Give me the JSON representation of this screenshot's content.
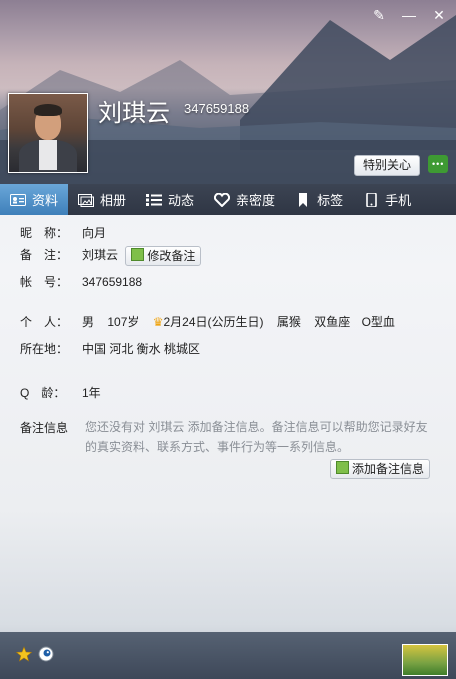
{
  "window": {
    "buttons": [
      "✎",
      "—",
      "✕"
    ]
  },
  "profile": {
    "name": "刘琪云",
    "qq_number": "347659188",
    "special_care_label": "特别关心"
  },
  "tabs": [
    {
      "label": "资料",
      "icon": "profile-card-icon",
      "active": true
    },
    {
      "label": "相册",
      "icon": "album-icon",
      "active": false
    },
    {
      "label": "动态",
      "icon": "feed-icon",
      "active": false
    },
    {
      "label": "亲密度",
      "icon": "heart-icon",
      "active": false
    },
    {
      "label": "标签",
      "icon": "bookmark-icon",
      "active": false
    },
    {
      "label": "手机",
      "icon": "phone-icon",
      "active": false
    }
  ],
  "info": {
    "nickname_label": "昵　称：",
    "nickname": "向月",
    "remark_label": "备　注：",
    "remark": "刘琪云",
    "edit_remark_label": "修改备注",
    "account_label": "帐　号：",
    "account": "347659188",
    "personal_label": "个　人：",
    "gender": "男",
    "age": "107岁",
    "birthday": "2月24日(公历生日)",
    "zodiac": "属猴",
    "constellation": "双鱼座",
    "blood_type": "O型血",
    "location_label": "所在地：",
    "location": "中国 河北 衡水 桃城区",
    "qage_label": "Q　龄：",
    "qage": "1年",
    "remark_info_label": "备注信息",
    "remark_info_text": "您还没有对 刘琪云 添加备注信息。备注信息可以帮助您记录好友的真实资料、联系方式、事件行为等一系列信息。",
    "add_remark_label": "添加备注信息"
  },
  "colors": {
    "tab_active": "#4a8cc6",
    "tab_bar": "#343c4a",
    "note_text": "#8a8f96",
    "chat_button": "#3e9a33"
  }
}
